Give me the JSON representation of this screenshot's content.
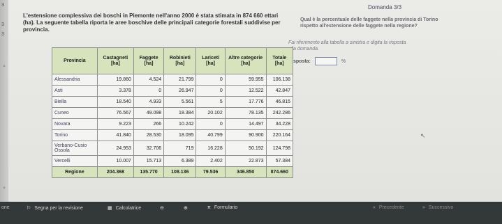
{
  "left_labels": [
    "3",
    "3",
    "3"
  ],
  "question_counter": "Domanda 3/3",
  "intro": "L'estensione complessiva dei boschi in Piemonte nell'anno 2000 è stata stimata in 874 660 ettari (ha). La seguente tabella riporta le aree boschive delle principali categorie forestali suddivise per provincia.",
  "question": "Qual è la percentuale delle faggete nella provincia di Torino rispetto all'estensione delle faggete nella regione?",
  "instruction": "Fai riferimento alla tabella a sinistra e digita la risposta alla domanda.",
  "answer": {
    "label": "Risposta:",
    "value": "",
    "unit": "%"
  },
  "table": {
    "headers": [
      "Provincia",
      "Castagneti [ha]",
      "Faggete [ha]",
      "Robinieti [ha]",
      "Lariceti [ha]",
      "Altre categorie [ha]",
      "Totale [ha]"
    ],
    "rows": [
      [
        "Alessandria",
        "19.860",
        "4.524",
        "21.799",
        "0",
        "59.955",
        "106.138"
      ],
      [
        "Asti",
        "3.378",
        "0",
        "26.947",
        "0",
        "12.522",
        "42.847"
      ],
      [
        "Biella",
        "18.540",
        "4.933",
        "5.561",
        "5",
        "17.776",
        "46.815"
      ],
      [
        "Cuneo",
        "76.567",
        "49.098",
        "18.384",
        "20.102",
        "78.135",
        "242.286"
      ],
      [
        "Novara",
        "9.223",
        "266",
        "10.242",
        "0",
        "14.497",
        "34.228"
      ],
      [
        "Torino",
        "41.840",
        "28.530",
        "18.095",
        "40.799",
        "90.900",
        "220.164"
      ],
      [
        "Verbano-Cusio Ossola",
        "24.953",
        "32.706",
        "719",
        "16.228",
        "50.192",
        "124.798"
      ],
      [
        "Vercelli",
        "10.007",
        "15.713",
        "6.389",
        "2.402",
        "22.873",
        "57.384"
      ]
    ],
    "total": [
      "Regione",
      "204.368",
      "135.770",
      "108.136",
      "79.536",
      "346.850",
      "874.660"
    ]
  },
  "toolbar": {
    "left_fragment": "one",
    "flag_label": "Segna per la revisione",
    "calculator_label": "Calcolatrice",
    "formulary_label": "Formulario",
    "prev_label": "Precedente",
    "next_label": "Successivo"
  }
}
